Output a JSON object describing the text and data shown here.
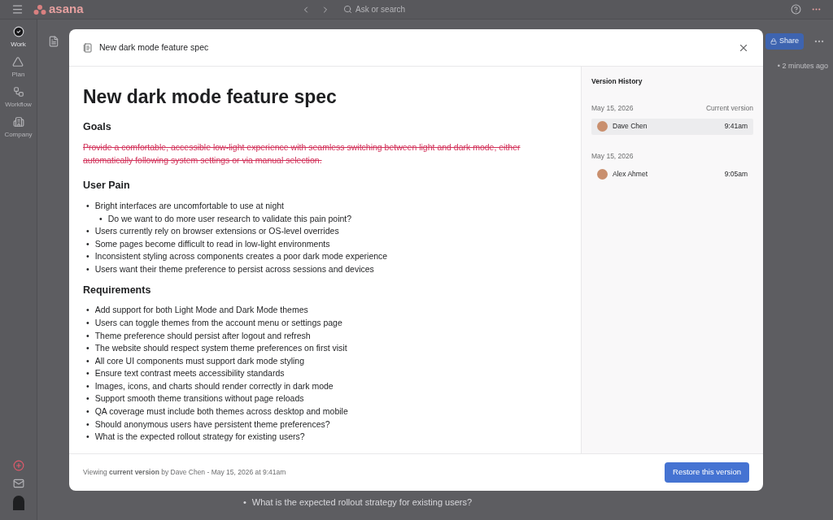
{
  "app": {
    "logo": "asana",
    "search": {
      "placeholder": "Ask or search"
    },
    "nav": [
      {
        "label": "Work",
        "selected": true
      },
      {
        "label": "Plan",
        "selected": false
      },
      {
        "label": "Workflow",
        "selected": false
      },
      {
        "label": "Company",
        "selected": false
      }
    ],
    "share_button": "Share",
    "updated": "• 2 minutes ago",
    "background_bullet": "•",
    "background_text": "What is the expected rollout strategy for existing users?"
  },
  "modal": {
    "title": "New dark mode feature spec",
    "blocks": [
      {
        "kind": "title",
        "text": "New dark mode feature spec"
      },
      {
        "kind": "heading",
        "text": "Goals"
      },
      {
        "kind": "paragraph",
        "struck": true,
        "text": "Provide a comfortable, accessible low-light experience with seamless switching between light and dark mode, either automatically following system settings or via manual selection."
      },
      {
        "kind": "heading",
        "text": "User Pain"
      },
      {
        "kind": "list",
        "bullet": "•",
        "items": [
          {
            "text": "Bright interfaces are uncomfortable to use at night",
            "children": [
              {
                "text": "Do we want to do more user research to validate this pain point?"
              }
            ]
          },
          {
            "text": "Users currently rely on browser extensions or OS-level overrides"
          },
          {
            "text": "Some pages become difficult to read in low-light environments"
          },
          {
            "text": "Inconsistent styling across components creates a poor dark mode experience"
          },
          {
            "text": "Users want their theme preference to persist across sessions and devices"
          }
        ]
      },
      {
        "kind": "heading",
        "text": "Requirements"
      },
      {
        "kind": "list",
        "bullet": "•",
        "items": [
          {
            "text": "Add support for both Light Mode and Dark Mode themes"
          },
          {
            "text": "Users can toggle themes from the account menu or settings page"
          },
          {
            "text": "Theme preference should persist after logout and refresh"
          },
          {
            "text": "The website should respect system theme preferences on first visit"
          },
          {
            "text": "All core UI components must support dark mode styling"
          },
          {
            "text": "Ensure text contrast meets accessibility standards"
          },
          {
            "text": "Images, icons, and charts should render correctly in dark mode"
          },
          {
            "text": "Support smooth theme transitions without page reloads"
          },
          {
            "text": "QA coverage must include both themes across desktop and mobile"
          },
          {
            "text": "Should anonymous users have persistent theme preferences?"
          },
          {
            "text": "What is the expected rollout strategy for existing users?"
          }
        ]
      }
    ],
    "history": {
      "title": "Version History",
      "groups": [
        {
          "date": "May 15, 2026",
          "label": "Current version",
          "versions": [
            {
              "author": "Dave Chen",
              "time": "9:41am",
              "selected": true
            }
          ]
        },
        {
          "date": "May 15, 2026",
          "versions": [
            {
              "author": "Alex Ahmet",
              "time": "9:05am",
              "selected": false
            }
          ]
        }
      ]
    },
    "footer": "Viewing **current version** by Dave Chen - May 15, 2026 at 9:41am",
    "restore_button": "Restore this version"
  }
}
